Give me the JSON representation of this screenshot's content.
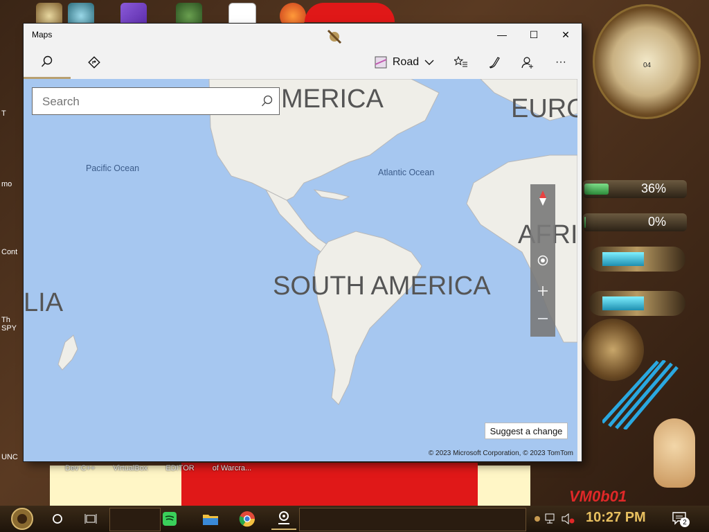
{
  "desktop": {
    "labels": [
      "Dev C++",
      "VirtualBox",
      "EDITOR",
      "of Warcra..."
    ],
    "rail_labels": [
      "T",
      "mo",
      "Cont",
      "Th SPY",
      "UNC"
    ],
    "widgets": {
      "meter1": {
        "value_text": "36%",
        "value": 0.36
      },
      "meter2": {
        "value_text": "0%",
        "value": 0.0
      },
      "clock_day": "04",
      "vm_text": "VM0b01"
    }
  },
  "window": {
    "title": "Maps",
    "controls": {
      "minimize": "—",
      "maximize": "☐",
      "close": "✕"
    }
  },
  "toolbar": {
    "view_mode": "Road",
    "more": "···"
  },
  "search": {
    "placeholder": "Search",
    "value": ""
  },
  "map": {
    "labels": {
      "north_america": "MERICA",
      "europe": "EURO",
      "africa": "AFRI",
      "south_america": "SOUTH AMERICA",
      "australia": "LIA",
      "pacific": "Pacific Ocean",
      "atlantic": "Atlantic Ocean"
    },
    "suggest_button": "Suggest a change",
    "copyright": "© 2023 Microsoft Corporation, © 2023 TomTom"
  },
  "taskbar": {
    "time": "10:27 PM",
    "notification_count": "2"
  },
  "colors": {
    "water": "#a6c7f0",
    "land": "#efeee8",
    "active_tab": "#b8a070"
  }
}
